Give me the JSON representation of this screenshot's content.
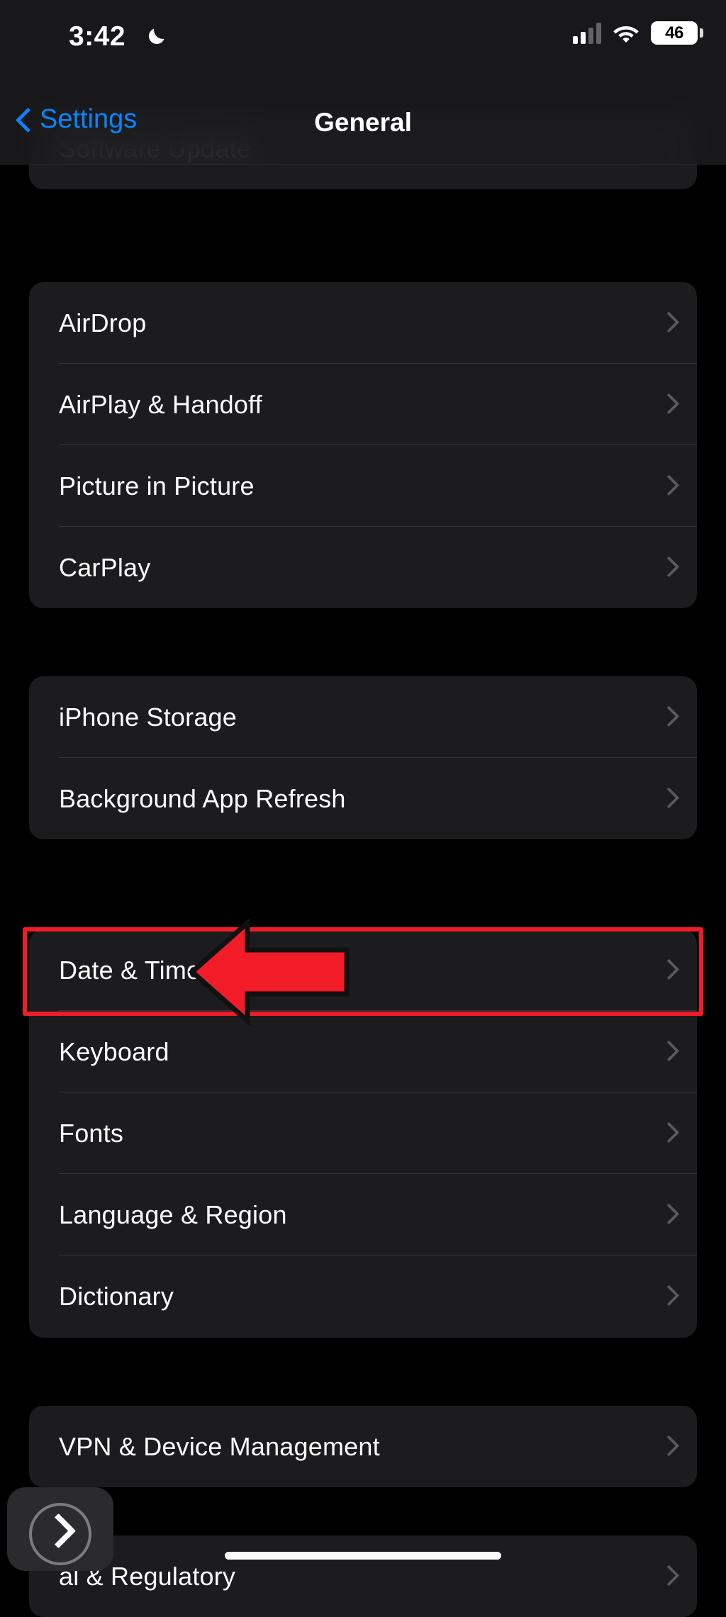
{
  "status_bar": {
    "time": "3:42",
    "focus_icon": "crescent-moon-icon",
    "cellular_icon": "cellular-bars-icon",
    "cellular_bars_filled": 2,
    "cellular_bars_total": 4,
    "wifi_icon": "wifi-icon",
    "battery_percent": "46"
  },
  "nav": {
    "back_label": "Settings",
    "back_icon": "chevron-left-icon",
    "title": "General"
  },
  "groups": [
    {
      "name": "update-group",
      "rows": [
        {
          "label": "Software Update",
          "accessory": "chevron-right-icon",
          "clipped": true
        }
      ]
    },
    {
      "name": "connectivity-group",
      "rows": [
        {
          "label": "AirDrop",
          "accessory": "chevron-right-icon"
        },
        {
          "label": "AirPlay & Handoff",
          "accessory": "chevron-right-icon"
        },
        {
          "label": "Picture in Picture",
          "accessory": "chevron-right-icon"
        },
        {
          "label": "CarPlay",
          "accessory": "chevron-right-icon"
        }
      ]
    },
    {
      "name": "storage-group",
      "rows": [
        {
          "label": "iPhone Storage",
          "accessory": "chevron-right-icon"
        },
        {
          "label": "Background App Refresh",
          "accessory": "chevron-right-icon"
        }
      ]
    },
    {
      "name": "localization-group",
      "rows": [
        {
          "label": "Date & Time",
          "accessory": "chevron-right-icon",
          "highlighted": true
        },
        {
          "label": "Keyboard",
          "accessory": "chevron-right-icon"
        },
        {
          "label": "Fonts",
          "accessory": "chevron-right-icon"
        },
        {
          "label": "Language & Region",
          "accessory": "chevron-right-icon"
        },
        {
          "label": "Dictionary",
          "accessory": "chevron-right-icon"
        }
      ]
    },
    {
      "name": "management-group",
      "rows": [
        {
          "label": "VPN & Device Management",
          "accessory": "chevron-right-icon"
        }
      ]
    },
    {
      "name": "legal-group",
      "rows": [
        {
          "label": "al & Regulatory",
          "accessory": "chevron-right-icon",
          "clipped": true
        }
      ]
    }
  ],
  "annotation": {
    "target_label": "Date & Time",
    "box_color": "#F21C29",
    "arrow_color": "#F21C29",
    "arrow_outline_color": "#111111",
    "arrow_direction": "left"
  },
  "floating_button": {
    "icon": "chevron-right-icon",
    "label": ""
  },
  "colors": {
    "background": "#000000",
    "group_background": "#1C1C1E",
    "separator": "#38383A",
    "accent_blue": "#0A84FF",
    "chevron_gray": "#5A5A5E",
    "text_primary": "#FFFFFF"
  }
}
